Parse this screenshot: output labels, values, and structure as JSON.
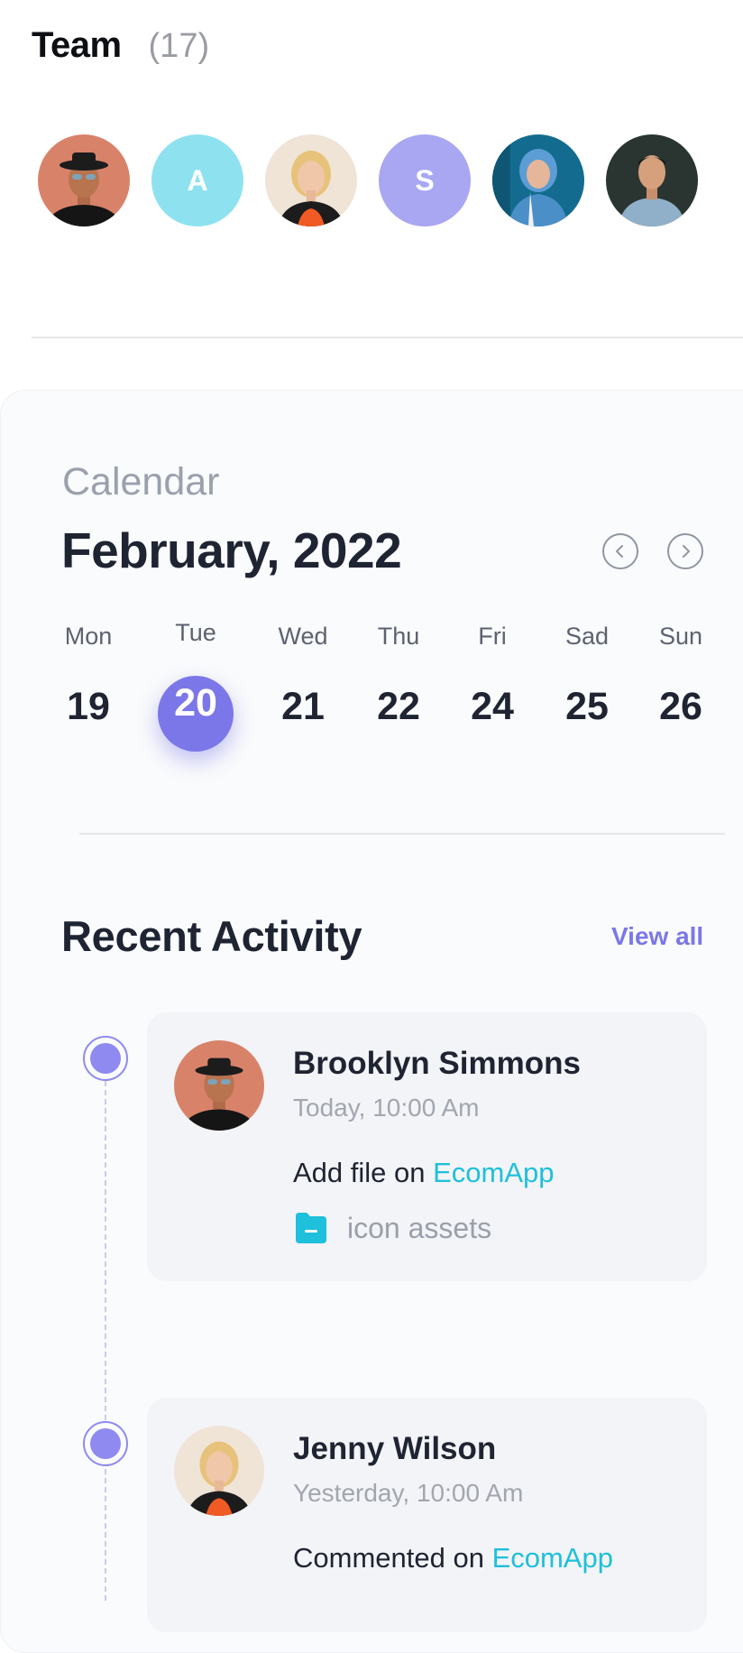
{
  "team": {
    "title": "Team",
    "count": "(17)",
    "members": [
      {
        "kind": "photo",
        "name": "team-member-1"
      },
      {
        "kind": "initial",
        "initial": "A",
        "color": "#8ee2f0"
      },
      {
        "kind": "photo",
        "name": "team-member-3"
      },
      {
        "kind": "initial",
        "initial": "S",
        "color": "#a9a6f2"
      },
      {
        "kind": "photo",
        "name": "team-member-5"
      },
      {
        "kind": "photo",
        "name": "team-member-6"
      }
    ]
  },
  "calendar": {
    "label": "Calendar",
    "month": "February, 2022",
    "prev_icon": "chevron-left-icon",
    "next_icon": "chevron-right-icon",
    "days": [
      {
        "name": "Mon",
        "num": "19"
      },
      {
        "name": "Tue",
        "num": "20",
        "active": true
      },
      {
        "name": "Wed",
        "num": "21"
      },
      {
        "name": "Thu",
        "num": "22"
      },
      {
        "name": "Fri",
        "num": "24"
      },
      {
        "name": "Sad",
        "num": "25"
      },
      {
        "name": "Sun",
        "num": "26"
      }
    ],
    "active_color": "#7b77e8"
  },
  "activity": {
    "title": "Recent Activity",
    "view_all": "View all",
    "items": [
      {
        "name": "Brooklyn Simmons",
        "time": "Today, 10:00 Am",
        "action_prefix": "Add file on ",
        "action_link": "EcomApp",
        "file_icon": "folder-icon",
        "file_name": "icon assets"
      },
      {
        "name": "Jenny Wilson",
        "time": "Yesterday, 10:00 Am",
        "action_prefix": "Commented on ",
        "action_link": "EcomApp"
      }
    ],
    "link_color": "#1ec0db",
    "accent_color": "#7b77e8"
  }
}
